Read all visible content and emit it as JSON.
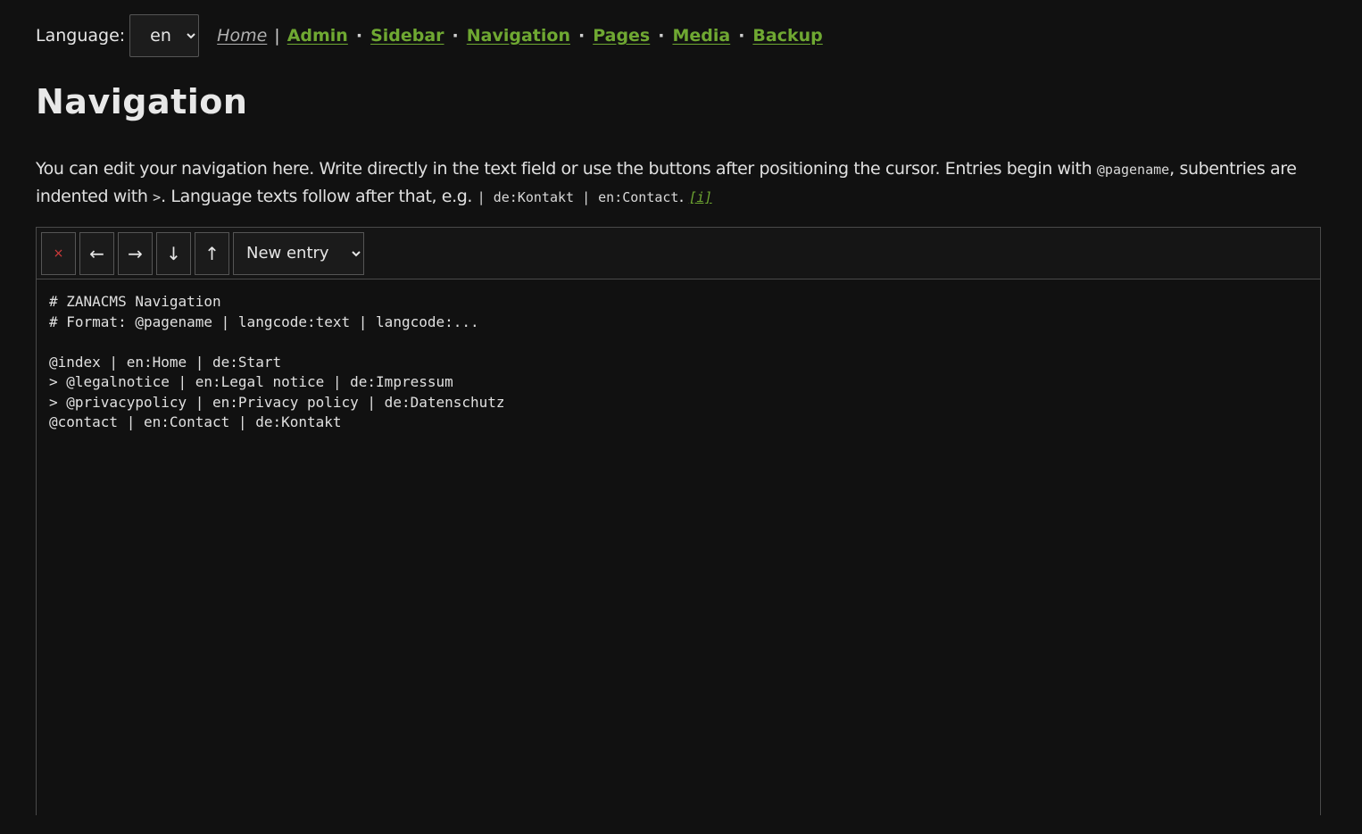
{
  "language": {
    "label": "Language:",
    "selected": "en"
  },
  "nav": {
    "home": "Home",
    "separator": "|",
    "dot": "·",
    "links": [
      "Admin",
      "Sidebar",
      "Navigation",
      "Pages",
      "Media",
      "Backup"
    ]
  },
  "page_title": "Navigation",
  "intro": {
    "text1": "You can edit your navigation here. Write directly in the text field or use the buttons after positioning the cursor. Entries begin with ",
    "code1": "@pagename",
    "text2": ", subentries are indented with ",
    "code2": ">",
    "text3": ". Language texts follow after that, e.g. ",
    "code3": "| de:Kontakt | en:Contact",
    "text4": ".",
    "info": "[i]"
  },
  "toolbar": {
    "delete_label": "×",
    "outdent_label": "←",
    "indent_label": "→",
    "move_down_label": "↓",
    "move_up_label": "↑",
    "new_entry_label": "New entry"
  },
  "editor": {
    "content": "# ZANACMS Navigation\n# Format: @pagename | langcode:text | langcode:...\n\n@index | en:Home | de:Start\n> @legalnotice | en:Legal notice | de:Impressum\n> @privacypolicy | en:Privacy policy | de:Datenschutz\n@contact | en:Contact | de:Kontakt"
  },
  "colors": {
    "background": "#111111",
    "link": "#6fa832",
    "delete": "#d43b3b"
  }
}
